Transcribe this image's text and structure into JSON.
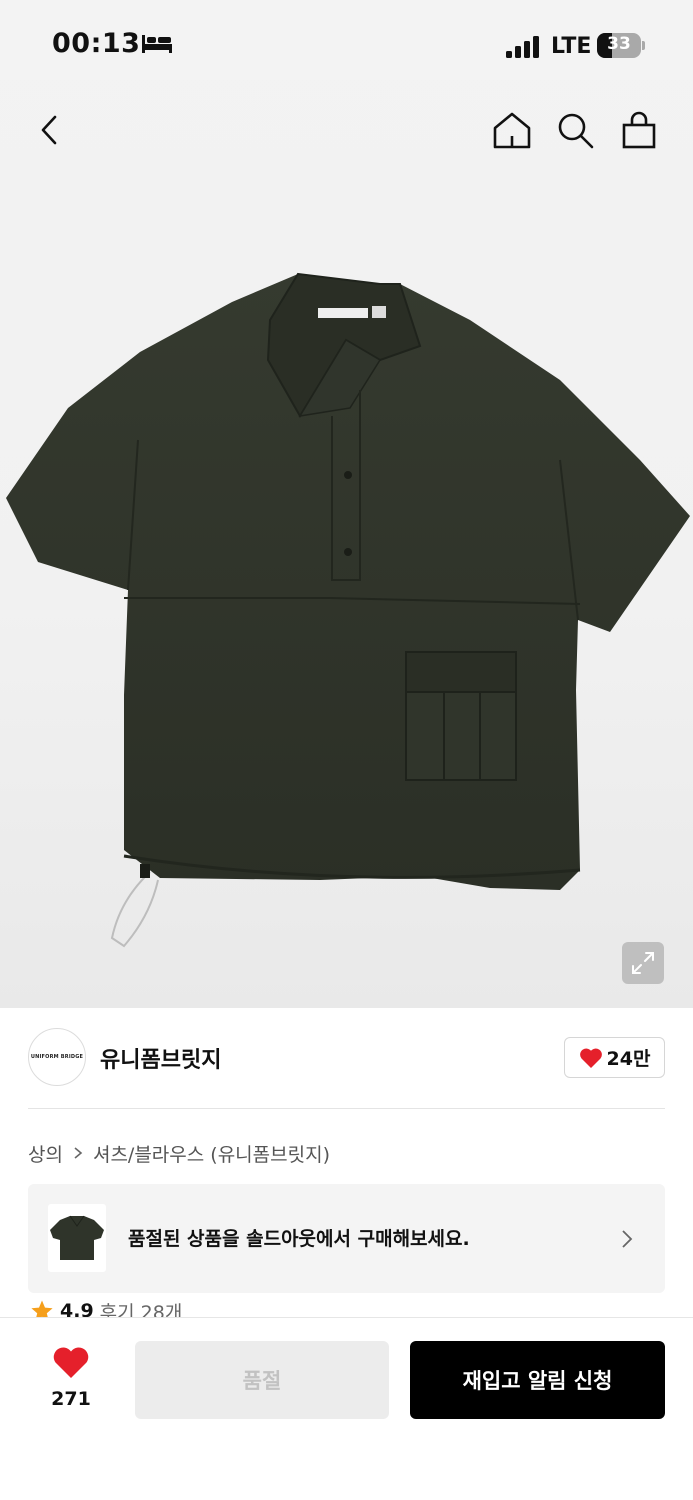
{
  "status_bar": {
    "time": "00:13",
    "network": "LTE",
    "battery_level": "33",
    "battery_fraction": 0.33,
    "icons": [
      "bed-icon",
      "signal-icon",
      "battery-icon"
    ]
  },
  "top_nav": {
    "icons": [
      "back-arrow-icon",
      "home-icon",
      "search-icon",
      "shopping-bag-icon"
    ]
  },
  "product_image": {
    "icon": "expand-icon"
  },
  "brand": {
    "logo_text": "UNIFORM BRIDGE",
    "name": "유니폼브릿지",
    "like_count": "24만",
    "like_icon": "heart-icon"
  },
  "breadcrumb": {
    "items": [
      "상의",
      "셔츠/블라우스 (유니폼브릿지)"
    ]
  },
  "soldout_banner": {
    "text": "품절된 상품을 솔드아웃에서 구매해보세요."
  },
  "rating": {
    "score": "4.9",
    "reviews": "후기 28개"
  },
  "bottom_bar": {
    "wish_count": "271",
    "soldout_label": "품절",
    "restock_label": "재입고 알림 신청"
  },
  "colors": {
    "accent_red": "#e5202b",
    "rating_star": "#f59f1c",
    "garment": "#2e3328"
  }
}
